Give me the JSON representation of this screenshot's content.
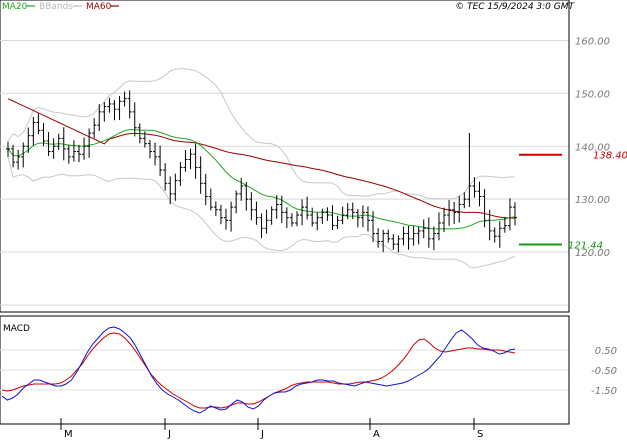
{
  "header": {
    "legend": [
      {
        "name": "MA20",
        "color": "#22a822"
      },
      {
        "name": "BBands",
        "color": "#bbbbbb"
      },
      {
        "name": "MA60",
        "color": "#990000"
      }
    ],
    "credit": "© TEC 15/9/2024 3:0 GMT"
  },
  "chart_data": [
    {
      "type": "ohlc",
      "panel": "price",
      "y_ticks": [
        120,
        130,
        140,
        150,
        160
      ],
      "ylim": [
        110,
        165
      ],
      "x_months": [
        "M",
        "J",
        "J",
        "A",
        "S"
      ],
      "grid": true,
      "legend_placement": "top-left",
      "series": [
        {
          "name": "MA20",
          "color": "#22a822"
        },
        {
          "name": "BBands",
          "color": "#bbbbbb"
        },
        {
          "name": "MA60",
          "color": "#990000"
        }
      ],
      "closes": [
        139.5,
        137.0,
        138.0,
        140.0,
        142.0,
        144.5,
        143.0,
        141.0,
        139.0,
        140.0,
        141.5,
        139.5,
        138.0,
        139.0,
        138.5,
        140.0,
        142.5,
        144.0,
        146.5,
        147.5,
        148.0,
        147.0,
        148.5,
        149.0,
        146.5,
        143.5,
        141.5,
        140.5,
        139.0,
        138.0,
        135.5,
        133.0,
        131.0,
        133.5,
        136.0,
        137.5,
        138.5,
        136.0,
        133.0,
        130.5,
        128.5,
        128.0,
        126.5,
        126.0,
        128.5,
        131.0,
        132.5,
        130.0,
        128.0,
        126.5,
        124.5,
        126.0,
        128.0,
        129.0,
        127.5,
        126.5,
        125.5,
        127.0,
        128.5,
        127.0,
        125.5,
        126.5,
        127.5,
        127.0,
        125.0,
        126.0,
        127.0,
        128.0,
        127.5,
        126.5,
        127.5,
        126.0,
        123.5,
        122.0,
        123.5,
        122.5,
        121.5,
        122.5,
        123.5,
        122.5,
        123.5,
        124.0,
        124.5,
        122.5,
        123.5,
        125.5,
        127.0,
        128.0,
        127.5,
        129.0,
        130.0,
        132.5,
        131.5,
        130.5,
        126.0,
        124.0,
        123.0,
        124.5,
        125.0,
        128.5,
        126.5
      ],
      "bollinger_upper_shown": true,
      "ma20_shown": true,
      "ma60_shown": true,
      "levels": [
        {
          "label": "138.40",
          "value": 138.4,
          "color": "#cc0000"
        },
        {
          "label": "121.44",
          "value": 121.44,
          "color": "#119911"
        }
      ]
    },
    {
      "type": "line",
      "panel": "MACD",
      "title": "MACD",
      "y_ticks": [
        {
          "label": "0.50",
          "value": 0.5
        },
        {
          "label": "-0.50",
          "value": -0.5
        },
        {
          "label": "-1.50",
          "value": -1.5
        }
      ],
      "ylim": [
        -3.0,
        2.0
      ],
      "series": [
        {
          "name": "MACD",
          "color": "#1111dd"
        },
        {
          "name": "Signal",
          "color": "#cc0000"
        }
      ],
      "macd": [
        -1.8,
        -2.0,
        -1.9,
        -1.7,
        -1.4,
        -1.2,
        -1.0,
        -1.0,
        -1.1,
        -1.2,
        -1.3,
        -1.3,
        -1.2,
        -1.0,
        -0.6,
        -0.1,
        0.4,
        0.8,
        1.1,
        1.4,
        1.6,
        1.65,
        1.55,
        1.35,
        1.1,
        0.7,
        0.2,
        -0.3,
        -0.8,
        -1.2,
        -1.5,
        -1.7,
        -1.85,
        -2.0,
        -2.2,
        -2.4,
        -2.55,
        -2.65,
        -2.5,
        -2.3,
        -2.4,
        -2.5,
        -2.45,
        -2.2,
        -2.0,
        -2.1,
        -2.35,
        -2.45,
        -2.3,
        -2.0,
        -1.8,
        -1.65,
        -1.6,
        -1.6,
        -1.5,
        -1.3,
        -1.2,
        -1.15,
        -1.1,
        -1.0,
        -1.0,
        -1.05,
        -1.05,
        -1.15,
        -1.2,
        -1.25,
        -1.3,
        -1.2,
        -1.1,
        -1.15,
        -1.2,
        -1.25,
        -1.3,
        -1.25,
        -1.2,
        -1.15,
        -1.05,
        -0.9,
        -0.75,
        -0.6,
        -0.4,
        -0.1,
        0.2,
        0.6,
        1.0,
        1.35,
        1.5,
        1.3,
        1.05,
        0.75,
        0.6,
        0.55,
        0.45,
        0.3,
        0.35,
        0.5,
        0.55
      ],
      "signal": [
        -1.5,
        -1.55,
        -1.5,
        -1.4,
        -1.3,
        -1.25,
        -1.2,
        -1.2,
        -1.2,
        -1.2,
        -1.2,
        -1.15,
        -1.0,
        -0.8,
        -0.5,
        -0.2,
        0.2,
        0.55,
        0.85,
        1.1,
        1.3,
        1.35,
        1.3,
        1.1,
        0.8,
        0.45,
        0.05,
        -0.35,
        -0.75,
        -1.05,
        -1.3,
        -1.5,
        -1.7,
        -1.85,
        -2.0,
        -2.15,
        -2.3,
        -2.4,
        -2.4,
        -2.35,
        -2.35,
        -2.4,
        -2.35,
        -2.25,
        -2.15,
        -2.15,
        -2.2,
        -2.2,
        -2.1,
        -1.95,
        -1.8,
        -1.65,
        -1.55,
        -1.45,
        -1.3,
        -1.2,
        -1.15,
        -1.1,
        -1.1,
        -1.1,
        -1.1,
        -1.1,
        -1.15,
        -1.2,
        -1.2,
        -1.2,
        -1.15,
        -1.1,
        -1.1,
        -1.05,
        -1.0,
        -0.9,
        -0.75,
        -0.55,
        -0.3,
        0.0,
        0.35,
        0.75,
        1.0,
        1.05,
        0.85,
        0.6,
        0.45,
        0.4,
        0.45,
        0.5,
        0.55,
        0.6,
        0.6,
        0.55,
        0.55,
        0.5,
        0.5,
        0.5,
        0.45,
        0.4,
        0.35
      ]
    }
  ]
}
